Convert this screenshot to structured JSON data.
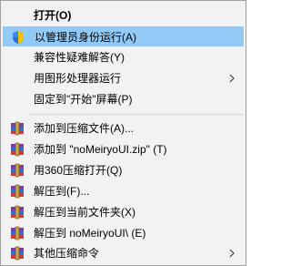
{
  "menu": {
    "items": [
      {
        "label": "打开(O)"
      },
      {
        "label": "以管理员身份运行(A)"
      },
      {
        "label": "兼容性疑难解答(Y)"
      },
      {
        "label": "用图形处理器运行"
      },
      {
        "label": "固定到\"开始\"屏幕(P)"
      },
      {
        "label": "添加到压缩文件(A)..."
      },
      {
        "label": "添加到 \"noMeiryoUI.zip\" (T)"
      },
      {
        "label": "用360压缩打开(Q)"
      },
      {
        "label": "解压到(F)..."
      },
      {
        "label": "解压到当前文件夹(X)"
      },
      {
        "label": "解压到 noMeiryoUI\\ (E)"
      },
      {
        "label": "其他压缩命令"
      }
    ]
  },
  "icons": {
    "run_as_admin": "uac-shield-icon",
    "archive": "winrar-archive-icon",
    "submenu": "chevron-right-icon"
  },
  "colors": {
    "menu_bg": "#f2f2f2",
    "hover_bg": "#91c9f7",
    "separator": "#d7d7d7",
    "border": "#a0a0a0"
  }
}
